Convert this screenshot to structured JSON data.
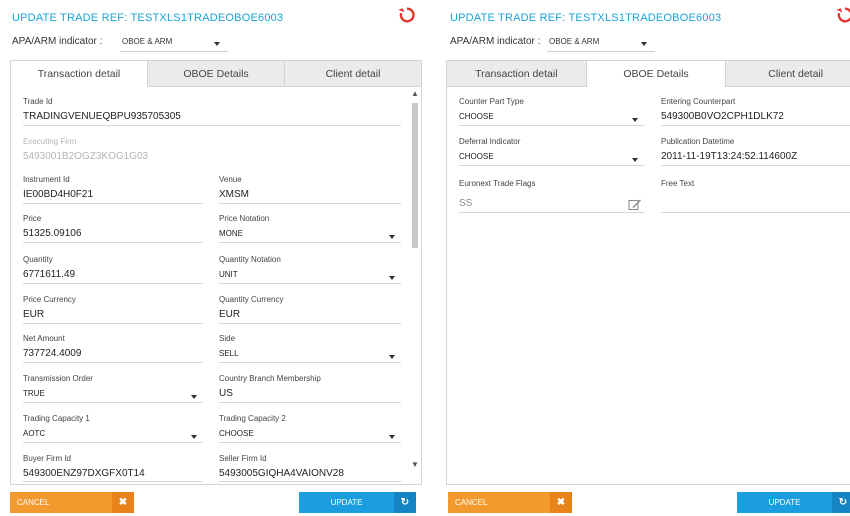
{
  "colors": {
    "title": "#1aa3d9",
    "cancel": "#f39a2e",
    "update": "#1b9ee0",
    "refresh": "#e5322d"
  },
  "left": {
    "title": "UPDATE TRADE REF: TESTXLS1TRADEOBOE6003",
    "apa_label": "APA/ARM indicator :",
    "apa_value": "OBOE & ARM",
    "tabs": [
      "Transaction detail",
      "OBOE Details",
      "Client detail"
    ],
    "active_tab": "Transaction detail",
    "fields": {
      "trade_id": {
        "label": "Trade Id",
        "value": "TRADINGVENUEQBPU935705305"
      },
      "executing_firm": {
        "label": "Executing Firm",
        "value": "5493001B2OGZ3KOG1G03"
      },
      "instrument_id": {
        "label": "Instrument Id",
        "value": "IE00BD4H0F21"
      },
      "venue": {
        "label": "Venue",
        "value": "XMSM"
      },
      "price": {
        "label": "Price",
        "value": "51325.09106"
      },
      "price_notation": {
        "label": "Price Notation",
        "value": "MONE"
      },
      "quantity": {
        "label": "Quantity",
        "value": "6771611.49"
      },
      "quantity_notation": {
        "label": "Quantity Notation",
        "value": "UNIT"
      },
      "price_currency": {
        "label": "Price Currency",
        "value": "EUR"
      },
      "quantity_currency": {
        "label": "Quantity Currency",
        "value": "EUR"
      },
      "net_amount": {
        "label": "Net Amount",
        "value": "737724.4009"
      },
      "side": {
        "label": "Side",
        "value": "SELL"
      },
      "transmission_order": {
        "label": "Transmission Order",
        "value": "TRUE"
      },
      "country_branch": {
        "label": "Country Branch Membership",
        "value": "US"
      },
      "trading_capacity_1": {
        "label": "Trading Capacity 1",
        "value": "AOTC"
      },
      "trading_capacity_2": {
        "label": "Trading Capacity 2",
        "value": "CHOOSE"
      },
      "buyer_firm_id": {
        "label": "Buyer Firm Id",
        "value": "549300ENZ97DXGFX0T14"
      },
      "seller_firm_id": {
        "label": "Seller Firm Id",
        "value": "5493005GIQHA4VAIONV28"
      }
    },
    "cancel_label": "CANCEL",
    "update_label": "UPDATE"
  },
  "right": {
    "title": "UPDATE TRADE REF: TESTXLS1TRADEOBOE6003",
    "apa_label": "APA/ARM indicator :",
    "apa_value": "OBOE & ARM",
    "tabs": [
      "Transaction detail",
      "OBOE Details",
      "Client detail"
    ],
    "active_tab": "OBOE Details",
    "fields": {
      "counter_part_type": {
        "label": "Counter Part Type",
        "value": "CHOOSE"
      },
      "entering_counterpart": {
        "label": "Entering Counterpart",
        "value": "549300B0VO2CPH1DLK72"
      },
      "deferral_indicator": {
        "label": "Deferral Indicator",
        "value": "CHOOSE"
      },
      "publication_datetime": {
        "label": "Publication Datetime",
        "value": "2011-11-19T13:24:52.114600Z"
      },
      "euronext_trade_flags": {
        "label": "Euronext Trade Flags",
        "value": "SS"
      },
      "free_text": {
        "label": "Free Text",
        "value": ""
      }
    },
    "cancel_label": "CANCEL",
    "update_label": "UPDATE"
  }
}
